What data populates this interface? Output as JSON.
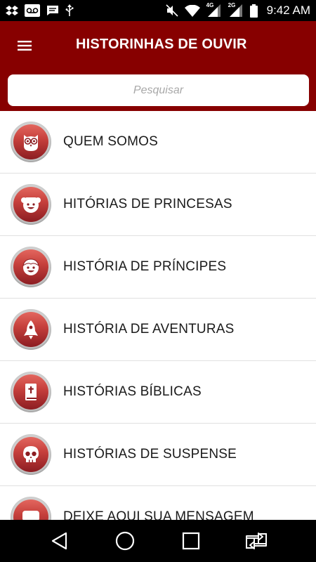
{
  "status_bar": {
    "time": "9:42 AM",
    "network_label_1": "4G",
    "network_label_2": "2G",
    "left_icons": [
      "dropbox-icon",
      "voicemail-icon",
      "message-icon",
      "usb-icon"
    ],
    "right_icons": [
      "mute-icon",
      "wifi-icon",
      "signal-4g-icon",
      "signal-2g-icon",
      "battery-icon"
    ]
  },
  "header": {
    "title": "HISTORINHAS DE OUVIR",
    "menu_icon": "hamburger-menu-icon",
    "color": "#870000"
  },
  "search": {
    "placeholder": "Pesquisar",
    "value": ""
  },
  "menu": {
    "items": [
      {
        "label": "QUEM SOMOS",
        "icon": "owl-icon"
      },
      {
        "label": "HITÓRIAS DE PRINCESAS",
        "icon": "princess-icon"
      },
      {
        "label": "HISTÓRIA DE PRÍNCIPES",
        "icon": "prince-icon"
      },
      {
        "label": "HISTÓRIA DE AVENTURAS",
        "icon": "rocket-icon"
      },
      {
        "label": "HISTÓRIAS BÍBLICAS",
        "icon": "bible-icon"
      },
      {
        "label": "HISTÓRIAS DE SUSPENSE",
        "icon": "skull-icon"
      },
      {
        "label": "DEIXE AQUI SUA MENSAGEM",
        "icon": "chat-bubble-icon"
      }
    ]
  },
  "nav_bar": {
    "buttons": [
      "back-icon",
      "home-icon",
      "recents-icon",
      "switch-app-icon"
    ]
  },
  "colors": {
    "accent": "#870000",
    "icon_gradient_top": "#e3675f",
    "icon_gradient_bottom": "#8c1d22"
  }
}
